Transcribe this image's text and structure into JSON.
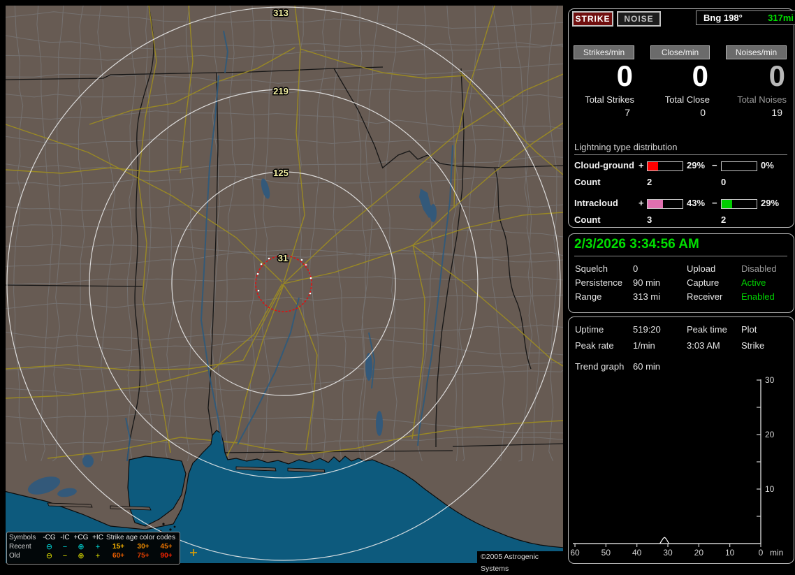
{
  "map": {
    "ring_labels": [
      "313",
      "219",
      "125",
      "31"
    ],
    "copyright": "©2005 Astrogenic Systems",
    "legend": {
      "col_headers": [
        "Symbols",
        "-CG",
        "-IC",
        "+CG",
        "+IC"
      ],
      "age_title": "Strike age color codes",
      "rows": [
        {
          "label": "Recent",
          "sym_color": "#00e0e0",
          "symbols": [
            "⊖",
            "−",
            "⊕",
            "+"
          ],
          "ages": [
            {
              "t": "15+",
              "c": "#ffb800"
            },
            {
              "t": "30+",
              "c": "#f08c00"
            },
            {
              "t": "45+",
              "c": "#ee7400"
            }
          ]
        },
        {
          "label": "Old",
          "sym_color": "#e6e600",
          "symbols": [
            "⊖",
            "−",
            "⊕",
            "+"
          ],
          "ages": [
            {
              "t": "60+",
              "c": "#ee6000"
            },
            {
              "t": "75+",
              "c": "#ea4000"
            },
            {
              "t": "90+",
              "c": "#ff2400"
            }
          ]
        }
      ]
    }
  },
  "panel_top": {
    "strike_btn": "STRIKE",
    "noise_btn": "NOISE",
    "bearing_label": "Bng 198°",
    "bearing_range": "317mi",
    "counters": [
      {
        "label": "Strikes/min",
        "value": "0",
        "value_color": "#ffffff",
        "total_label": "Total Strikes",
        "label_color": "#e8e8e8",
        "total": "7"
      },
      {
        "label": "Close/min",
        "value": "0",
        "value_color": "#ffffff",
        "total_label": "Total Close",
        "label_color": "#e8e8e8",
        "total": "0"
      },
      {
        "label": "Noises/min",
        "value": "0",
        "value_color": "#b8b8b8",
        "total_label": "Total Noises",
        "label_color": "#9c9c9c",
        "total": "19"
      }
    ],
    "distribution": {
      "title": "Lightning type distribution",
      "rows": [
        {
          "name": "Cloud-ground",
          "pos_sign": "+",
          "pos_fill": 29,
          "pos_color": "#ff0000",
          "pos_pct": "29%",
          "neg_sign": "−",
          "neg_fill": 0,
          "neg_color": "#00cc00",
          "neg_pct": "0%",
          "count_label": "Count",
          "pos_count": "2",
          "neg_count": "0"
        },
        {
          "name": "Intracloud",
          "pos_sign": "+",
          "pos_fill": 43,
          "pos_color": "#e070b0",
          "pos_pct": "43%",
          "neg_sign": "−",
          "neg_fill": 29,
          "neg_color": "#00cc00",
          "neg_pct": "29%",
          "count_label": "Count",
          "pos_count": "3",
          "neg_count": "2"
        }
      ]
    }
  },
  "panel_clock": {
    "datetime": "2/3/2026 3:34:56 AM",
    "rows": [
      {
        "l1": "Squelch",
        "v1": "0",
        "l2": "Upload",
        "v2": "Disabled",
        "v2_color": "#9a9a9a"
      },
      {
        "l1": "Persistence",
        "v1": "90 min",
        "l2": "Capture",
        "v2": "Active",
        "v2_color": "#00d400"
      },
      {
        "l1": "Range",
        "v1": "313 mi",
        "l2": "Receiver",
        "v2": "Enabled",
        "v2_color": "#00d400"
      }
    ]
  },
  "panel_stats": {
    "rows": [
      {
        "l1": "Uptime",
        "v1": "519:20",
        "l2": "Peak time",
        "v2": "Plot"
      },
      {
        "l1": "Peak rate",
        "v1": "1/min",
        "l2": "3:03 AM",
        "v2": "Strike"
      }
    ],
    "trend_label": "Trend graph",
    "trend_value": "60 min",
    "chart": {
      "type": "line",
      "y_ticks": [
        "30",
        "20",
        "10"
      ],
      "x_ticks": [
        "60",
        "50",
        "40",
        "30",
        "20",
        "10",
        "0"
      ],
      "x_unit": "min",
      "ylim": [
        0,
        30
      ],
      "xlim_minutes_ago": [
        60,
        0
      ],
      "bump_min": 31,
      "bump_height": 1
    }
  }
}
